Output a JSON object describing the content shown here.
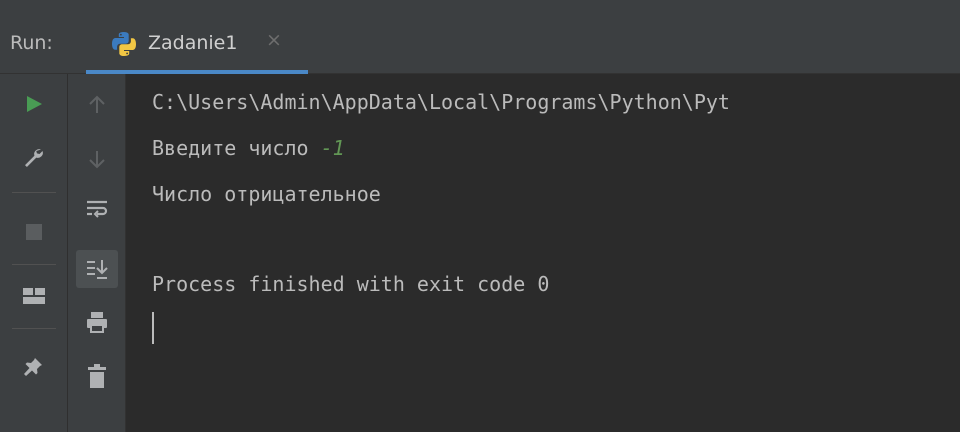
{
  "run_panel": {
    "label": "Run:",
    "tab": {
      "title": "Zadanie1",
      "close_glyph": "×",
      "icon": "python-icon"
    }
  },
  "toolbar_left": [
    {
      "name": "rerun-icon",
      "color": "#499c54"
    },
    {
      "name": "wrench-icon",
      "color": "#afb1b3"
    },
    {
      "name": "stop-icon",
      "color": "#5a5d5f"
    },
    {
      "name": "layout-icon",
      "color": "#afb1b3"
    },
    {
      "name": "pin-icon",
      "color": "#afb1b3"
    }
  ],
  "toolbar_right": [
    {
      "name": "arrow-up-icon"
    },
    {
      "name": "arrow-down-icon"
    },
    {
      "name": "soft-wrap-icon"
    },
    {
      "name": "scroll-to-end-icon"
    },
    {
      "name": "print-icon"
    },
    {
      "name": "trash-icon"
    }
  ],
  "console": {
    "line1": "C:\\Users\\Admin\\AppData\\Local\\Programs\\Python\\Pyt",
    "line2_prompt": "Введите число ",
    "line2_input": "-1",
    "line3": "Число отрицательное",
    "line4": "Process finished with exit code 0"
  },
  "colors": {
    "background": "#2b2b2b",
    "panel": "#3c3f41",
    "accent": "#4a88c7",
    "text": "#bbbbbb",
    "input_text": "#629755"
  }
}
